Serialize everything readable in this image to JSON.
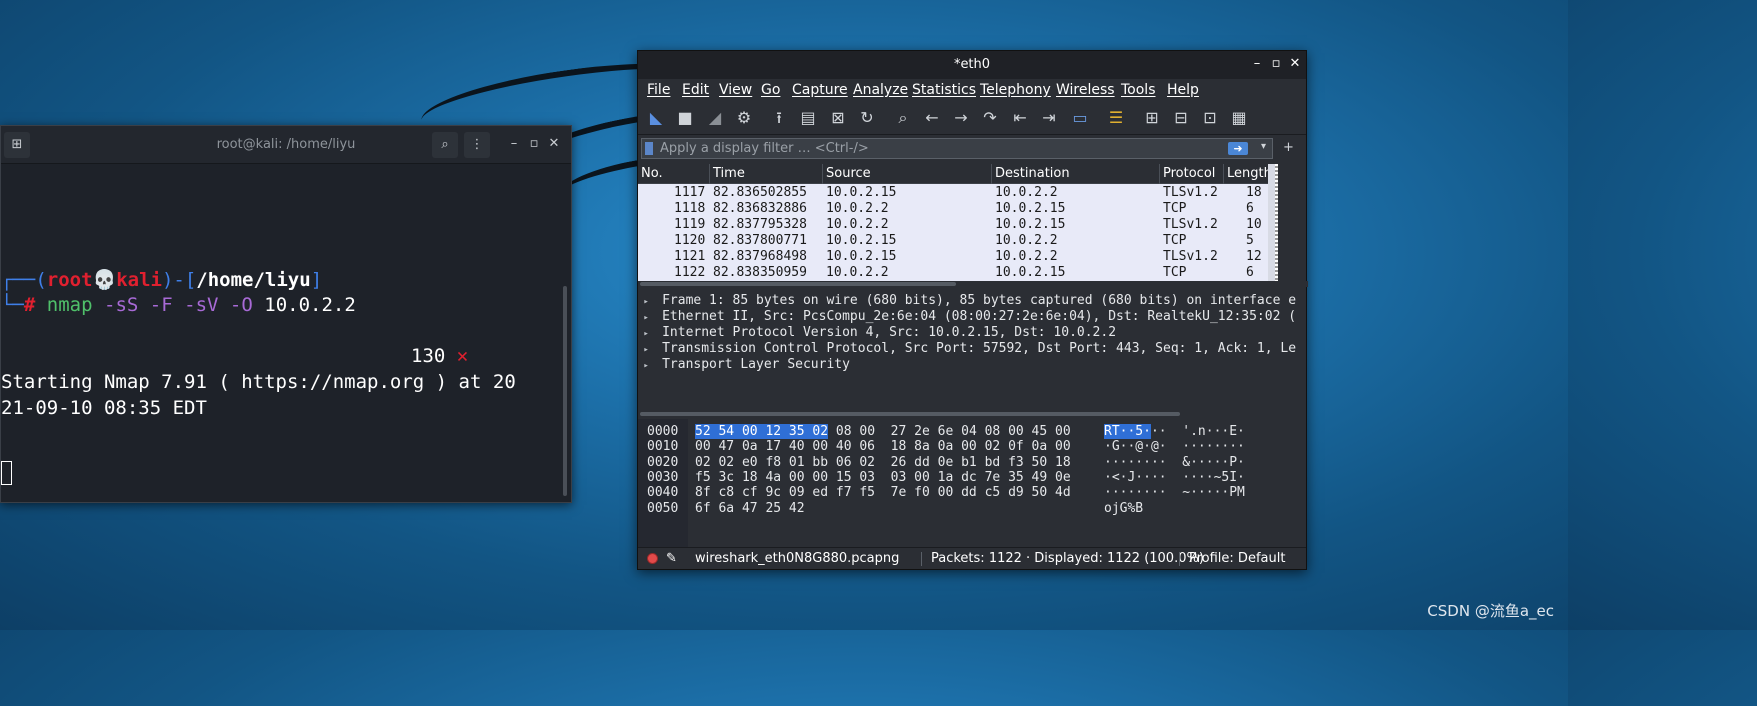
{
  "terminal": {
    "title": "root@kali: /home/liyu",
    "prompt_user": "root",
    "prompt_skull": "💀",
    "prompt_host": "kali",
    "prompt_path": "/home/liyu",
    "prompt_hash": "#",
    "command": {
      "cmd": "nmap",
      "opt1": "-sS",
      "opt2": "-F",
      "opt3": "-sV",
      "opt4": "-O",
      "target": "10.0.2.2"
    },
    "exit_code": "130",
    "exit_mark": "✕",
    "output": [
      "Starting Nmap 7.91 ( https://nmap.org ) at 20",
      "21-09-10 08:35 EDT"
    ]
  },
  "wireshark": {
    "title": "*eth0",
    "menu": [
      "File",
      "Edit",
      "View",
      "Go",
      "Capture",
      "Analyze",
      "Statistics",
      "Telephony",
      "Wireless",
      "Tools",
      "Help"
    ],
    "filter_placeholder": "Apply a display filter … <Ctrl-/>",
    "columns": [
      "No.",
      "Time",
      "Source",
      "Destination",
      "Protocol",
      "Length"
    ],
    "packets": [
      {
        "no": "1117",
        "time": "82.836502855",
        "src": "10.0.2.15",
        "dst": "10.0.2.2",
        "proto": "TLSv1.2",
        "len": "18"
      },
      {
        "no": "1118",
        "time": "82.836832886",
        "src": "10.0.2.2",
        "dst": "10.0.2.15",
        "proto": "TCP",
        "len": "6"
      },
      {
        "no": "1119",
        "time": "82.837795328",
        "src": "10.0.2.2",
        "dst": "10.0.2.15",
        "proto": "TLSv1.2",
        "len": "10"
      },
      {
        "no": "1120",
        "time": "82.837800771",
        "src": "10.0.2.15",
        "dst": "10.0.2.2",
        "proto": "TCP",
        "len": "5"
      },
      {
        "no": "1121",
        "time": "82.837968498",
        "src": "10.0.2.15",
        "dst": "10.0.2.2",
        "proto": "TLSv1.2",
        "len": "12"
      },
      {
        "no": "1122",
        "time": "82.838350959",
        "src": "10.0.2.2",
        "dst": "10.0.2.15",
        "proto": "TCP",
        "len": "6"
      }
    ],
    "details": [
      "Frame 1: 85 bytes on wire (680 bits), 85 bytes captured (680 bits) on interface e",
      "Ethernet II, Src: PcsCompu_2e:6e:04 (08:00:27:2e:6e:04), Dst: RealtekU_12:35:02 (",
      "Internet Protocol Version 4, Src: 10.0.2.15, Dst: 10.0.2.2",
      "Transmission Control Protocol, Src Port: 57592, Dst Port: 443, Seq: 1, Ack: 1, Le",
      "Transport Layer Security"
    ],
    "hex": [
      {
        "offset": "0000",
        "hl": "52 54 00 12 35 02",
        "bytes": " 08 00  27 2e 6e 04 08 00 45 00",
        "ascii_hl": "RT··5·",
        "ascii": "··  '.n···E·"
      },
      {
        "offset": "0010",
        "hl": "",
        "bytes": "00 47 0a 17 40 00 40 06  18 8a 0a 00 02 0f 0a 00",
        "ascii_hl": "",
        "ascii": "·G··@·@·  ········"
      },
      {
        "offset": "0020",
        "hl": "",
        "bytes": "02 02 e0 f8 01 bb 06 02  26 dd 0e b1 bd f3 50 18",
        "ascii_hl": "",
        "ascii": "········  &·····P·"
      },
      {
        "offset": "0030",
        "hl": "",
        "bytes": "f5 3c 18 4a 00 00 15 03  03 00 1a dc 7e 35 49 0e",
        "ascii_hl": "",
        "ascii": "·<·J····  ····~5I·"
      },
      {
        "offset": "0040",
        "hl": "",
        "bytes": "8f c8 cf 9c 09 ed f7 f5  7e f0 00 dd c5 d9 50 4d",
        "ascii_hl": "",
        "ascii": "········  ~·····PM"
      },
      {
        "offset": "0050",
        "hl": "",
        "bytes": "6f 6a 47 25 42",
        "ascii_hl": "",
        "ascii": "ojG%B"
      }
    ],
    "status": {
      "file": "wireshark_eth0N8G880.pcapng",
      "packets": "Packets: 1122 · Displayed: 1122 (100.0%)",
      "profile": "Profile: Default"
    },
    "colors": {
      "packet_row_bg": "#e8eaf8",
      "selection": "#2f6fd6"
    }
  },
  "watermark": "CSDN @流鱼a_ec"
}
